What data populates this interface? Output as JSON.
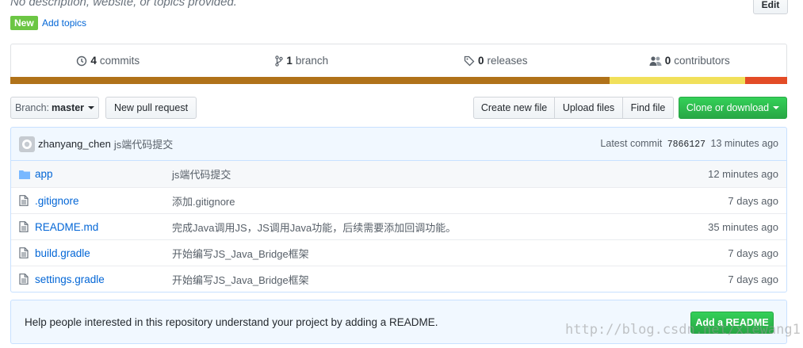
{
  "repo": {
    "description": "No description, website, or topics provided.",
    "edit_label": "Edit",
    "new_badge": "New",
    "add_topics": "Add topics"
  },
  "numbers": {
    "commits_count": "4",
    "commits_label": "commits",
    "branch_count": "1",
    "branch_label": "branch",
    "releases_count": "0",
    "releases_label": "releases",
    "contributors_count": "0",
    "contributors_label": "contributors"
  },
  "languages": [
    {
      "share": 0.771,
      "color": "#b07219"
    },
    {
      "share": 0.175,
      "color": "#f1e05a"
    },
    {
      "share": 0.054,
      "color": "#e34c26"
    }
  ],
  "toolbar": {
    "branch_prefix": "Branch:",
    "branch_name": "master",
    "new_pull_request": "New pull request",
    "create_new_file": "Create new file",
    "upload_files": "Upload files",
    "find_file": "Find file",
    "clone_or_download": "Clone or download"
  },
  "commit": {
    "author": "zhanyang_chen",
    "message": "js端代码提交",
    "latest_label": "Latest commit",
    "sha": "7866127",
    "age": "13 minutes ago"
  },
  "files": [
    {
      "type": "folder",
      "name": "app",
      "message": "js端代码提交",
      "age": "12 minutes ago"
    },
    {
      "type": "file",
      "name": ".gitignore",
      "message": "添加.gitignore",
      "age": "7 days ago"
    },
    {
      "type": "file",
      "name": "README.md",
      "message": "完成Java调用JS，JS调用Java功能，后续需要添加回调功能。",
      "age": "35 minutes ago"
    },
    {
      "type": "file",
      "name": "build.gradle",
      "message": "开始编写JS_Java_Bridge框架",
      "age": "7 days ago"
    },
    {
      "type": "file",
      "name": "settings.gradle",
      "message": "开始编写JS_Java_Bridge框架",
      "age": "7 days ago"
    }
  ],
  "readme_prompt": {
    "text": "Help people interested in this repository understand your project by adding a README.",
    "button": "Add a README"
  },
  "watermark": "http://blog.csdn.net/xiewang1"
}
